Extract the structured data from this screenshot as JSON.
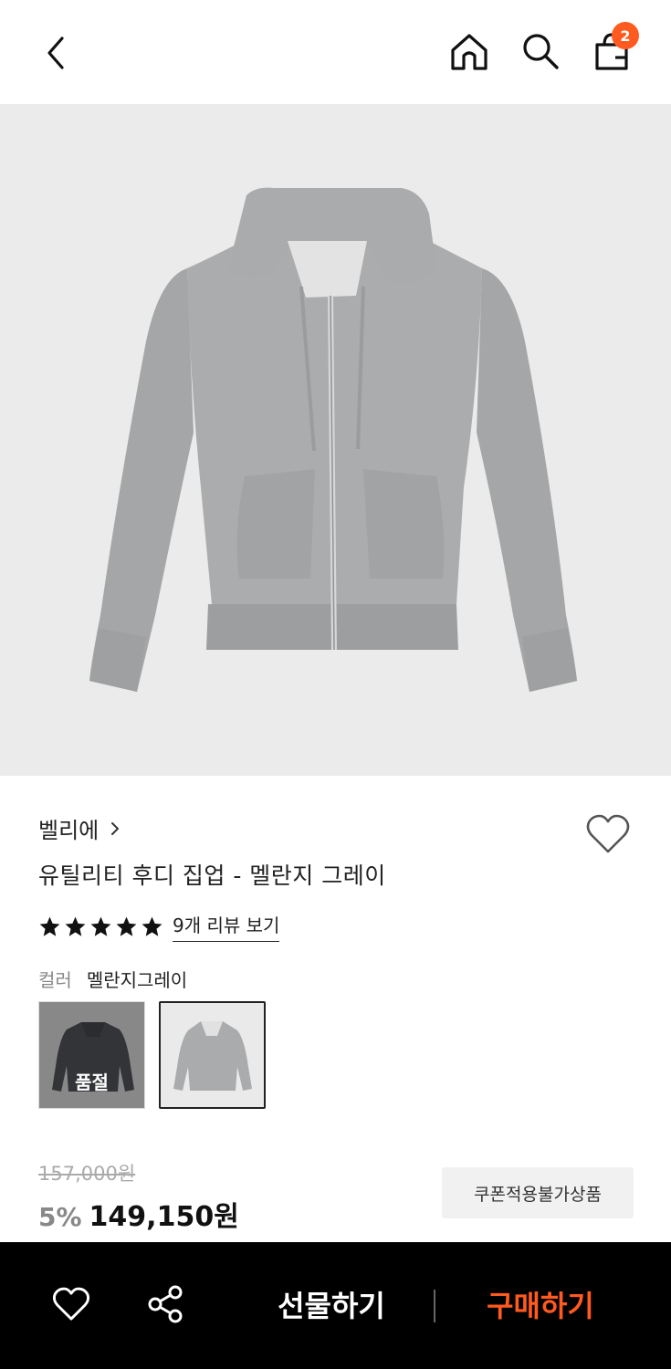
{
  "header": {
    "cart_count": "2"
  },
  "product": {
    "brand": "벨리에",
    "title": "유틸리티 후디 집업 - 멜란지 그레이",
    "rating_stars": 5,
    "review_link": "9개 리뷰 보기",
    "color_label": "컬러",
    "color_value": "멜란지그레이",
    "swatches": [
      {
        "name": "charcoal",
        "status": "품절",
        "color": "#3c3f45"
      },
      {
        "name": "melange-gray",
        "color": "#a9abad"
      }
    ],
    "original_price": "157,000원",
    "discount": "5%",
    "sale_price": "149,150원",
    "coupon_note": "쿠폰적용불가상품"
  },
  "bottom_bar": {
    "gift_label": "선물하기",
    "buy_label": "구매하기"
  },
  "colors": {
    "accent": "#ff5a1f",
    "hero_bg": "#ebebeb",
    "hoodie_gray": "#a6a8aa"
  }
}
